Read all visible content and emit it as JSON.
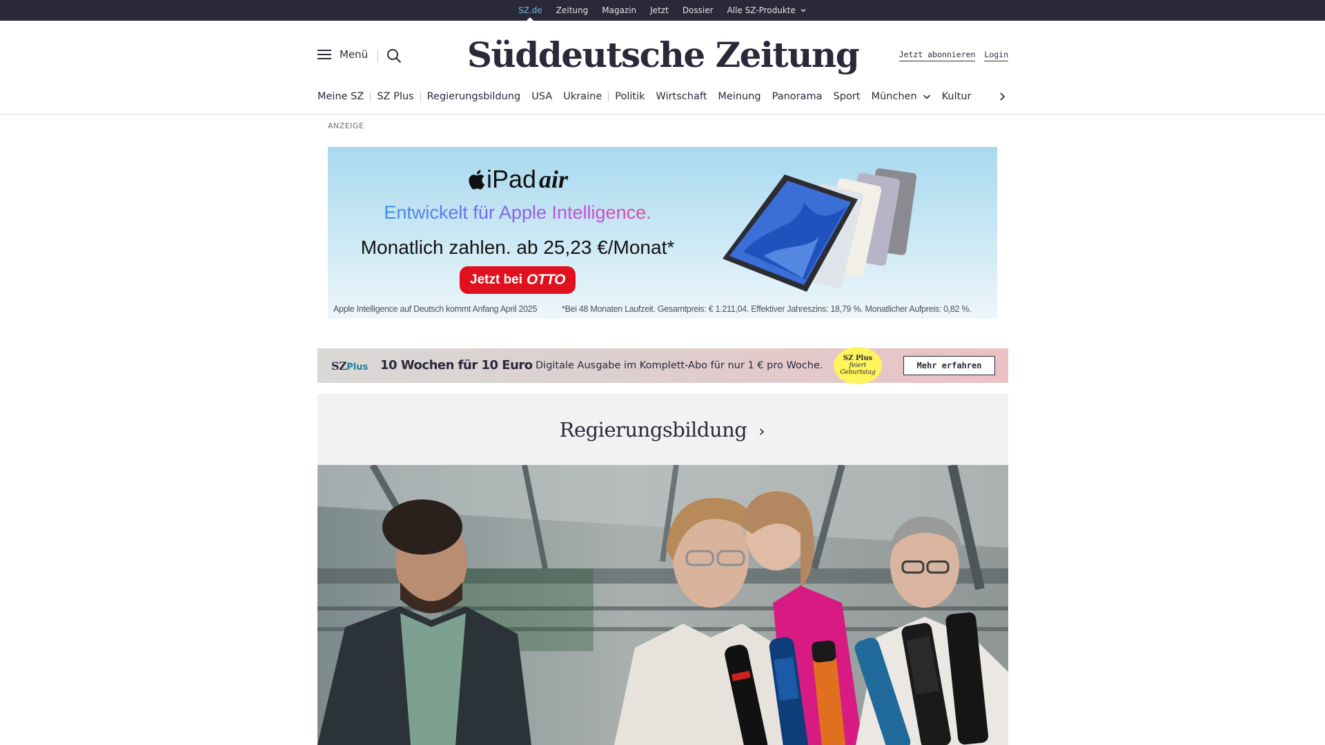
{
  "topbar": {
    "links": [
      {
        "label": "SZ.de",
        "active": true
      },
      {
        "label": "Zeitung"
      },
      {
        "label": "Magazin"
      },
      {
        "label": "Jetzt"
      },
      {
        "label": "Dossier"
      },
      {
        "label": "Alle SZ-Produkte",
        "dropdown": true
      }
    ]
  },
  "masthead": {
    "menu_label": "Menü",
    "logo": "Süddeutsche Zeitung",
    "subscribe_label": "Jetzt abonnieren",
    "login_label": "Login"
  },
  "nav": {
    "items": [
      {
        "label": "Meine SZ"
      },
      {
        "label": "SZ Plus"
      },
      {
        "label": "Regierungsbildung"
      },
      {
        "label": "USA"
      },
      {
        "label": "Ukraine"
      },
      {
        "label": "Politik"
      },
      {
        "label": "Wirtschaft"
      },
      {
        "label": "Meinung"
      },
      {
        "label": "Panorama"
      },
      {
        "label": "Sport"
      },
      {
        "label": "München",
        "dropdown": true
      },
      {
        "label": "Kultur"
      }
    ]
  },
  "ad": {
    "label": "ANZEIGE",
    "brand": "iPad",
    "model": "air",
    "headline": "Entwickelt für Apple Intelligence.",
    "price": "Monatlich zahlen. ab 25,23 €/Monat*",
    "cta_prefix": "Jetzt bei",
    "cta_brand": "OTTO",
    "footnote_left": "Apple Intelligence auf Deutsch kommt Anfang April 2025",
    "footnote_right": "*Bei 48 Monaten Laufzeit. Gesamtpreis: € 1.211,04. Effektiver Jahreszins: 18,79 %. Monatlicher Aufpreis: 0,82 %."
  },
  "promo": {
    "logo_sz": "SZ",
    "logo_plus": "Plus",
    "headline": "10 Wochen für 10 Euro",
    "text": "Digitale Ausgabe im Komplett-Abo für nur 1 € pro Woche.",
    "badge_line1": "SZ Plus",
    "badge_line2": "feiert",
    "badge_line3": "Geburtstag",
    "cta": "Mehr erfahren"
  },
  "topic": {
    "title": "Regierungsbildung"
  },
  "colors": {
    "brand_dark": "#29293a",
    "active_link": "#71b6d9",
    "otto_red": "#e0101e",
    "promo_badge": "#fff45c",
    "szplus_teal": "#1c7f9e"
  },
  "icons": {
    "menu": "hamburger-icon",
    "search": "search-icon",
    "nav_next": "chevron-right-icon",
    "dropdown": "chevron-down-icon",
    "topic_link": "chevron-right-icon",
    "apple": "apple-logo-icon"
  }
}
